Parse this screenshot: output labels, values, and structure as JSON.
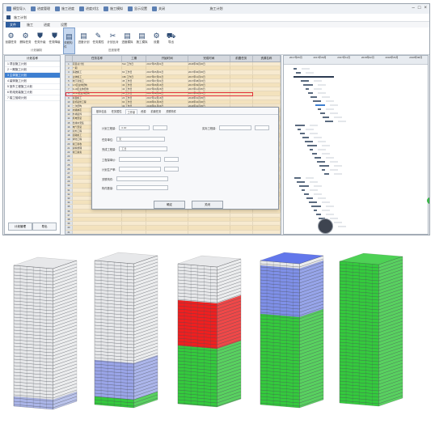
{
  "app": {
    "title": "施工计划",
    "quick_toolbar": [
      "模型导入",
      "进度管理",
      "施工进度",
      "进度对比",
      "施工模拟",
      "显示设置",
      "关闭"
    ],
    "subbar_label": "施工计划",
    "ribbon_tabs": [
      "文件",
      "施工",
      "进度",
      "设置"
    ],
    "active_ribbon_tab": "文件",
    "ribbon_buttons": [
      {
        "label": "创建任务",
        "icon": "gear-icon"
      },
      {
        "label": "删除任务",
        "icon": "gear-icon"
      },
      {
        "label": "任务升级",
        "icon": "shield-icon"
      },
      {
        "label": "任务降级",
        "icon": "shield-icon"
      },
      {
        "label": "关联构件",
        "icon": "document-icon"
      },
      {
        "label": "进度计划",
        "icon": "document-icon"
      },
      {
        "label": "任务属性",
        "icon": "wrench-icon"
      },
      {
        "label": "计划比对",
        "icon": "scissors-icon"
      },
      {
        "label": "进度模拟",
        "icon": "document-icon"
      },
      {
        "label": "施工模拟",
        "icon": "document-icon"
      },
      {
        "label": "设置",
        "icon": "gear-icon"
      },
      {
        "label": "导出",
        "icon": "truck-icon"
      }
    ],
    "ribbon_groups": [
      "计划编制",
      "进度管理"
    ],
    "left_panel": {
      "header": "计划名称",
      "items": [
        "1 项目施工计划",
        "2 一期施工计划",
        "3 主体施工计划",
        "4 装饰施工计划",
        "5 室外工程施工计划",
        "6 机电安装施工计划",
        "7 竣工验收计划"
      ],
      "selected_index": 2,
      "buttons": [
        "计划管理",
        "导出"
      ]
    },
    "grid": {
      "columns": [
        "",
        "任务名称",
        "工期",
        "开始时间",
        "完成时间",
        "前置任务",
        "资源名称"
      ],
      "rows": [
        [
          "1",
          "项目总计划",
          "512 工作日",
          "2017年05月01日",
          "2018年09月30日",
          "",
          ""
        ],
        [
          "2",
          "一期",
          "",
          "",
          "",
          "",
          ""
        ],
        [
          "3",
          "基础施工",
          "60 工作日",
          "2017年05月01日",
          "2017年06月30日",
          "",
          ""
        ],
        [
          "4",
          "主体施工",
          "180 工作日",
          "2017年07月01日",
          "2017年12月31日",
          "",
          ""
        ],
        [
          "5",
          "地下室施工",
          "45 工作日",
          "2017年07月01日",
          "2017年08月15日",
          "",
          ""
        ],
        [
          "6",
          "1-5层主体结构",
          "40 工作日",
          "2017年08月16日",
          "2017年09月25日",
          "",
          ""
        ],
        [
          "7",
          "6-10层主体结构",
          "40 工作日",
          "2017年09月26日",
          "2017年11月05日",
          "",
          ""
        ],
        [
          "8",
          "11-15层主体结构",
          "40 工作日",
          "2017年11月06日",
          "2017年12月15日",
          "",
          ""
        ],
        [
          "9",
          "屋面施工",
          "20 工作日",
          "2017年12月16日",
          "2018年01月05日",
          "",
          ""
        ],
        [
          "10",
          "装饰装修工程",
          "90 工作日",
          "2018年01月06日",
          "2018年04月06日",
          "",
          ""
        ],
        [
          "11",
          "二次结构",
          "30 工作日",
          "2018年01月06日",
          "2018年02月05日",
          "",
          ""
        ],
        [
          "12",
          "内墙抹灰",
          "30 工作日",
          "2018年02月06日",
          "2018年03月08日",
          "",
          ""
        ],
        [
          "13",
          "外墙装饰",
          "35 工作日",
          "2018年03月09日",
          "2018年04月12日",
          "",
          ""
        ],
        [
          "14",
          "机电安装",
          "60 工作日",
          "2018年04月13日",
          "2018年06月12日",
          "",
          ""
        ],
        [
          "15",
          "给排水安装",
          "30 工作日",
          "2018年04月13日",
          "2018年05月13日",
          "",
          ""
        ],
        [
          "16",
          "电气安装",
          "30 工作日",
          "2018年05月14日",
          "2018年06月12日",
          "",
          ""
        ],
        [
          "17",
          "室外工程",
          "45 工作日",
          "2018年06月13日",
          "2018年07月28日",
          "",
          ""
        ],
        [
          "18",
          "道路施工",
          "20 工作日",
          "2018年06月13日",
          "2018年07月03日",
          "",
          ""
        ],
        [
          "19",
          "绿化工程",
          "25 工作日",
          "2018年07月04日",
          "2018年07月28日",
          "",
          ""
        ],
        [
          "20",
          "竣工验收",
          "30 工作日",
          "2018年08月01日",
          "2018年08月31日",
          "",
          ""
        ],
        [
          "21",
          "资料整理",
          "15 工作日",
          "2018年09月01日",
          "2018年09月15日",
          "",
          ""
        ],
        [
          "22",
          "竣工备案",
          "15 工作日",
          "2018年09月16日",
          "2018年09月30日",
          "",
          ""
        ]
      ],
      "highlighted_row": 9
    },
    "gantt": {
      "header_months": [
        "2017年05月",
        "2017年08月",
        "2017年11月",
        "2018年02月",
        "2018年05月",
        "2018年08月"
      ]
    },
    "dialog": {
      "tabs": [
        "基本信息",
        "任务属性",
        "工作量",
        "资源",
        "前置任务",
        "关联构件"
      ],
      "active_tab": "工作量",
      "fields": [
        {
          "label": "计划工程量:",
          "value": "0.00"
        },
        {
          "label": "实际工程量:",
          "value": ""
        },
        {
          "label": "任务单位:",
          "value": "天"
        },
        {
          "label": "完成工程量:",
          "value": "工日"
        },
        {
          "label": "工程量单价:",
          "value": ""
        },
        {
          "label": "计划生产率:",
          "value": ""
        },
        {
          "label": "关联构件:",
          "value": ""
        },
        {
          "label": "构件数量:",
          "value": ""
        }
      ],
      "buttons": [
        "确定",
        "关闭"
      ]
    }
  },
  "buildings": {
    "count": 5,
    "colors": {
      "frame": "#9ea3aa",
      "blue": "#3b55e6",
      "green": "#20c62a",
      "red": "#f01414"
    },
    "states": [
      {
        "name": "base",
        "fills": []
      },
      {
        "name": "foundation",
        "fills": [
          "green-base",
          "blue-lower"
        ]
      },
      {
        "name": "lower-complete",
        "fills": [
          "green-lower",
          "red-middle"
        ]
      },
      {
        "name": "middle-complete",
        "fills": [
          "green-lower",
          "green-middle",
          "blue-top"
        ]
      },
      {
        "name": "all-complete",
        "fills": [
          "green-all"
        ]
      }
    ]
  }
}
